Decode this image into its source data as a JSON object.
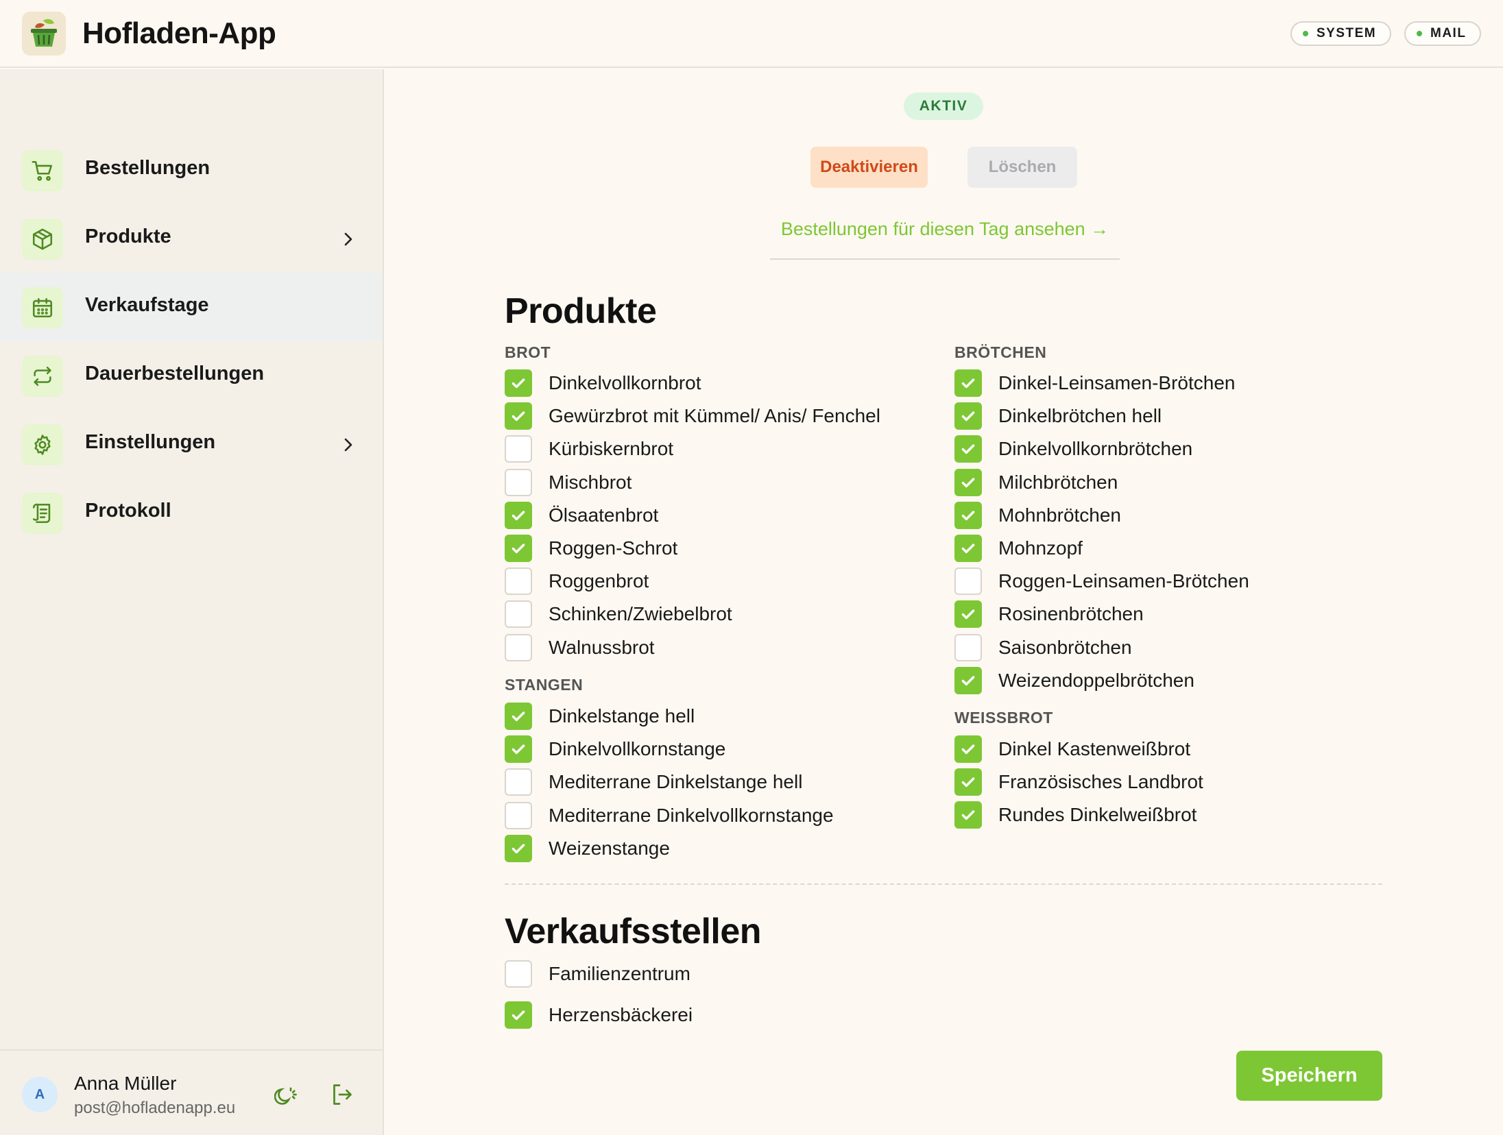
{
  "header": {
    "app_title": "Hofladen-App",
    "logo_icon": "basket-icon",
    "pills": [
      {
        "label": "SYSTEM",
        "status_color": "#4cbb48"
      },
      {
        "label": "MAIL",
        "status_color": "#4cbb48"
      }
    ]
  },
  "sidebar": {
    "items": [
      {
        "label": "Bestellungen",
        "icon": "cart-icon",
        "active": false,
        "has_chevron": false
      },
      {
        "label": "Produkte",
        "icon": "box-icon",
        "active": false,
        "has_chevron": true
      },
      {
        "label": "Verkaufstage",
        "icon": "calendar-icon",
        "active": true,
        "has_chevron": false
      },
      {
        "label": "Dauerbestellungen",
        "icon": "repeat-icon",
        "active": false,
        "has_chevron": false
      },
      {
        "label": "Einstellungen",
        "icon": "gear-icon",
        "active": false,
        "has_chevron": true
      },
      {
        "label": "Protokoll",
        "icon": "scroll-icon",
        "active": false,
        "has_chevron": false
      }
    ],
    "user": {
      "avatar_initial": "A",
      "name": "Anna Müller",
      "email": "post@hofladenapp.eu"
    }
  },
  "main": {
    "status_badge": "AKTIV",
    "deactivate_label": "Deaktivieren",
    "delete_label": "Löschen",
    "day_orders_link": "Bestellungen für diesen Tag ansehen →",
    "products_title": "Produkte",
    "groups": {
      "brot": {
        "title": "BROT",
        "items": [
          {
            "label": "Dinkelvollkornbrot",
            "checked": true
          },
          {
            "label": "Gewürzbrot mit Kümmel/ Anis/ Fenchel",
            "checked": true
          },
          {
            "label": "Kürbiskernbrot",
            "checked": false
          },
          {
            "label": "Mischbrot",
            "checked": false
          },
          {
            "label": "Ölsaatenbrot",
            "checked": true
          },
          {
            "label": "Roggen-Schrot",
            "checked": true
          },
          {
            "label": "Roggenbrot",
            "checked": false
          },
          {
            "label": "Schinken/Zwiebelbrot",
            "checked": false
          },
          {
            "label": "Walnussbrot",
            "checked": false
          }
        ]
      },
      "stangen": {
        "title": "STANGEN",
        "items": [
          {
            "label": "Dinkelstange hell",
            "checked": true
          },
          {
            "label": "Dinkelvollkornstange",
            "checked": true
          },
          {
            "label": "Mediterrane Dinkelstange hell",
            "checked": false
          },
          {
            "label": "Mediterrane Dinkelvollkornstange",
            "checked": false
          },
          {
            "label": "Weizenstange",
            "checked": true
          }
        ]
      },
      "broetchen": {
        "title": "BRÖTCHEN",
        "items": [
          {
            "label": "Dinkel-Leinsamen-Brötchen",
            "checked": true
          },
          {
            "label": "Dinkelbrötchen hell",
            "checked": true
          },
          {
            "label": "Dinkelvollkornbrötchen",
            "checked": true
          },
          {
            "label": "Milchbrötchen",
            "checked": true
          },
          {
            "label": "Mohnbrötchen",
            "checked": true
          },
          {
            "label": "Mohnzopf",
            "checked": true
          },
          {
            "label": "Roggen-Leinsamen-Brötchen",
            "checked": false
          },
          {
            "label": "Rosinenbrötchen",
            "checked": true
          },
          {
            "label": "Saisonbrötchen",
            "checked": false
          },
          {
            "label": "Weizendoppelbrötchen",
            "checked": true
          }
        ]
      },
      "weissbrot": {
        "title": "WEISSBROT",
        "items": [
          {
            "label": "Dinkel Kastenweißbrot",
            "checked": true
          },
          {
            "label": "Französisches Landbrot",
            "checked": true
          },
          {
            "label": "Rundes Dinkelweißbrot",
            "checked": true
          }
        ]
      }
    },
    "stores_title": "Verkaufsstellen",
    "stores": [
      {
        "label": "Familienzentrum",
        "checked": false
      },
      {
        "label": "Herzensbäckerei",
        "checked": true
      }
    ],
    "save_label": "Speichern"
  },
  "colors": {
    "accent": "#7dc734",
    "background": "#fdf8f1",
    "sidebar_bg": "#f4f0e8",
    "warning_text": "#d0491a"
  }
}
